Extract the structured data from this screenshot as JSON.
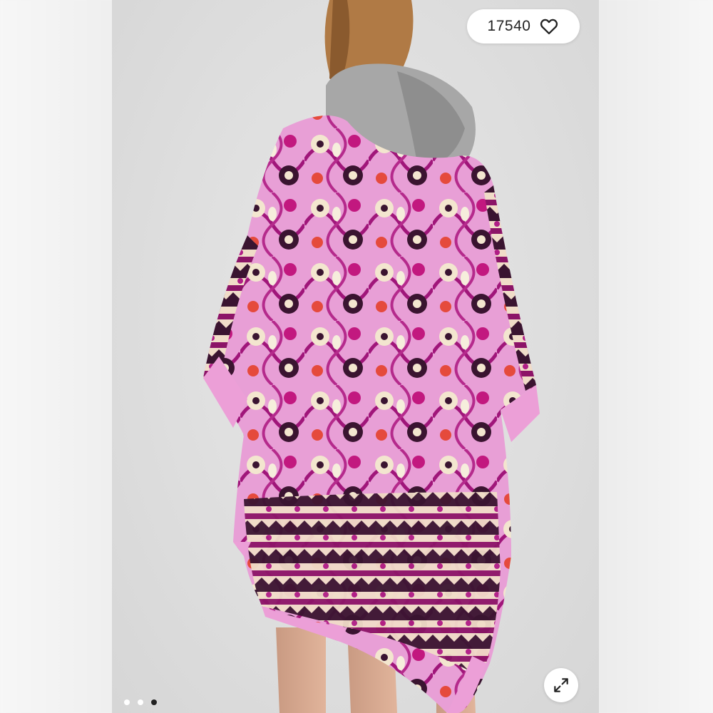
{
  "listing": {
    "like_count": "17540",
    "like_icon": "heart-outline-icon",
    "expand_icon": "expand-arrows-icon"
  },
  "carousel": {
    "total_images": 3,
    "active_index": 2
  },
  "colors": {
    "kimono_pink": "#e8a0d8",
    "kimono_magenta": "#b01e86",
    "hoodie_gray": "#a7a7a7",
    "background": "#dedede"
  }
}
